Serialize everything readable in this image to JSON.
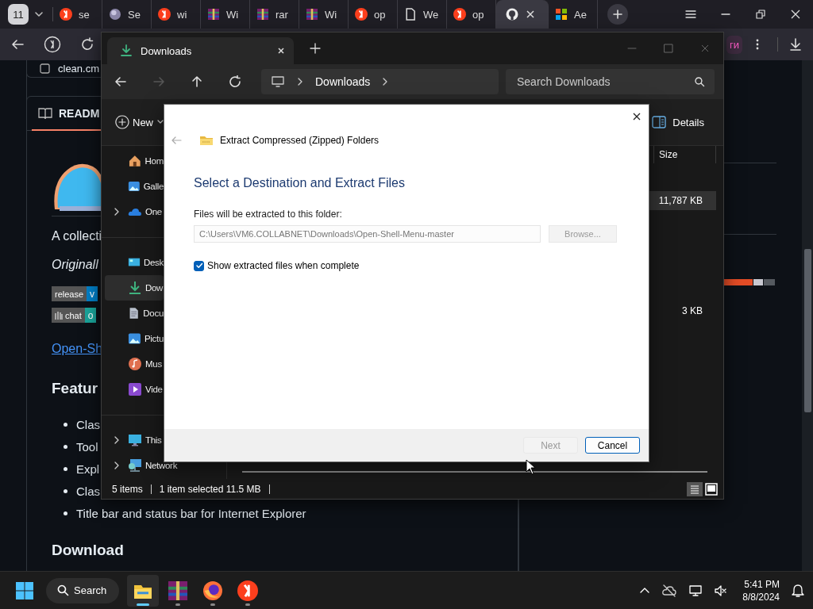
{
  "browser": {
    "tab_count": "11",
    "tabs": [
      {
        "kind": "yandex",
        "label": "se",
        "selected": false
      },
      {
        "kind": "orb",
        "label": "Se",
        "selected": false
      },
      {
        "kind": "yandex",
        "label": "wi",
        "selected": false
      },
      {
        "kind": "archive",
        "label": "Wi",
        "selected": false
      },
      {
        "kind": "archive",
        "label": "rar",
        "selected": false
      },
      {
        "kind": "archive",
        "label": "Wi",
        "selected": false
      },
      {
        "kind": "yandex",
        "label": "op",
        "selected": false
      },
      {
        "kind": "page",
        "label": "We",
        "selected": false
      },
      {
        "kind": "yandex",
        "label": "op",
        "selected": false
      },
      {
        "kind": "github",
        "selected": true
      },
      {
        "kind": "windows",
        "label": "Ae",
        "selected": false
      }
    ],
    "toolbar_tag": "ги"
  },
  "page": {
    "file": "clean.cm",
    "readme_tab": "READM",
    "intro": "A collecti",
    "credit": "Originall",
    "badges": [
      {
        "kind": "plain",
        "label": "release",
        "value": "v",
        "color": "#007ec6"
      },
      {
        "kind": "chat",
        "label": "chat",
        "value": "o",
        "color": "#1aa39a"
      }
    ],
    "link": "Open-Sh",
    "features_heading": "Featur",
    "features": [
      "Clas",
      "Tool",
      "Expl",
      "Clas",
      "Title bar and status bar for Internet Explorer"
    ],
    "download_heading": "Download"
  },
  "explorer": {
    "tab": "Downloads",
    "address": "Downloads",
    "search": {
      "placeholder": "Search Downloads"
    },
    "new": "New",
    "details": "Details",
    "sidebar": {
      "groups": [
        [
          {
            "kind": "home",
            "label": "Hom",
            "has_children": false,
            "selected": false
          },
          {
            "kind": "gallery",
            "label": "Galle",
            "has_children": false,
            "selected": false
          },
          {
            "kind": "cloud",
            "label": "One",
            "has_children": true,
            "selected": false
          }
        ],
        [
          {
            "kind": "desktop",
            "label": "Desk",
            "has_children": false,
            "selected": false
          },
          {
            "kind": "download",
            "label": "Dow",
            "has_children": false,
            "selected": true
          },
          {
            "kind": "document",
            "label": "Docu",
            "has_children": false,
            "selected": false
          },
          {
            "kind": "gallery",
            "label": "Pictu",
            "has_children": false,
            "selected": false
          },
          {
            "kind": "music",
            "label": "Mus",
            "has_children": false,
            "selected": false
          },
          {
            "kind": "video",
            "label": "Vide",
            "has_children": false,
            "selected": false
          }
        ],
        [
          {
            "kind": "monitor",
            "label": "This",
            "has_children": true,
            "selected": false
          },
          {
            "kind": "network",
            "label": "Network",
            "has_children": true,
            "selected": false
          }
        ]
      ]
    },
    "columns": [
      "Size"
    ],
    "rows": [
      {
        "size": "11,787 KB",
        "selected": true
      },
      {
        "size": "3 KB",
        "selected": false
      }
    ],
    "status": {
      "count": "5 items",
      "selection": "1 item selected  11.5 MB"
    }
  },
  "dialog": {
    "title": "Extract Compressed (Zipped) Folders",
    "heading": "Select a Destination and Extract Files",
    "field_label": "Files will be extracted to this folder:",
    "path": "C:\\Users\\VM6.COLLABNET\\Downloads\\Open-Shell-Menu-master",
    "browse": {
      "label": "Browse...",
      "disabled": true
    },
    "show_files": {
      "label": "Show extracted files when complete",
      "checked": true
    },
    "buttons": [
      {
        "label": "Next",
        "disabled": true
      },
      {
        "label": "Cancel",
        "disabled": false
      }
    ]
  },
  "taskbar": {
    "search": "Search",
    "apps": [
      {
        "kind": "folder",
        "active": true
      },
      {
        "kind": "archive",
        "active": false
      },
      {
        "kind": "firefox",
        "active": false
      },
      {
        "kind": "yandex",
        "active": false
      }
    ],
    "time": "5:41 PM",
    "date": "8/8/2024"
  }
}
